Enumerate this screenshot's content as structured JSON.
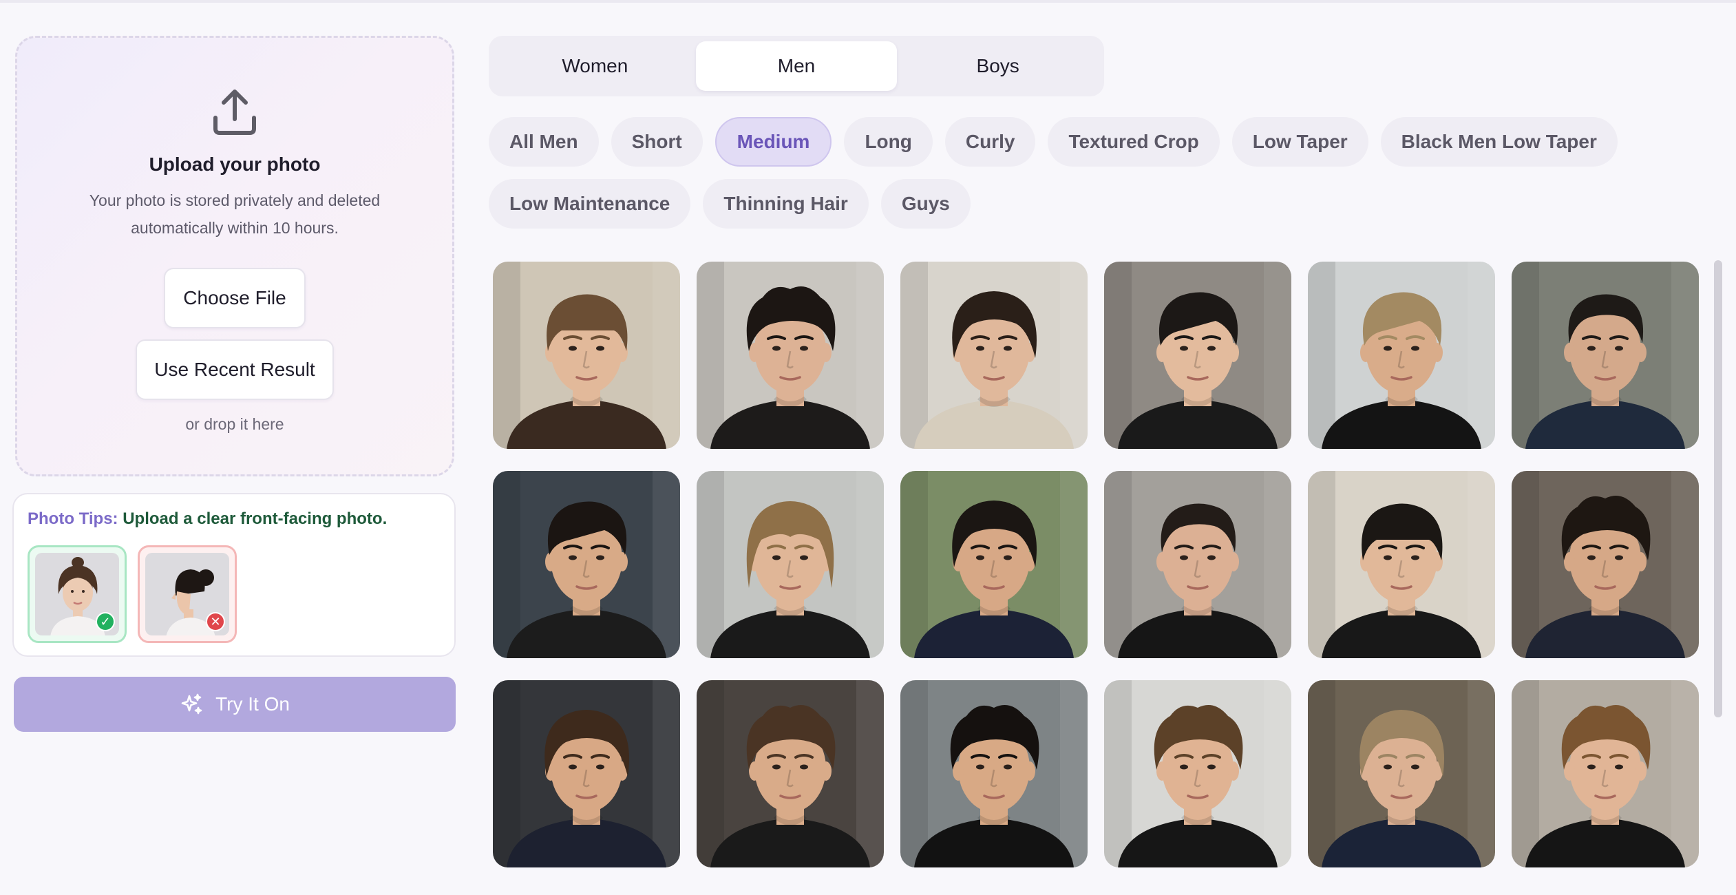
{
  "upload": {
    "title": "Upload your photo",
    "description": "Your photo is stored privately and deleted automatically within 10 hours.",
    "choose_file": "Choose File",
    "use_recent": "Use Recent Result",
    "drop_hint": "or drop it here"
  },
  "tips": {
    "label": "Photo Tips:",
    "message": "Upload a clear front-facing photo."
  },
  "try_button": "Try It On",
  "tabs": [
    "Women",
    "Men",
    "Boys"
  ],
  "active_tab": "Men",
  "filters": {
    "row1": [
      "All Men",
      "Short",
      "Medium",
      "Long",
      "Curly",
      "Textured Crop",
      "Low Taper",
      "Black Men Low Taper"
    ],
    "row2": [
      "Low Maintenance",
      "Thinning Hair",
      "Guys"
    ],
    "active": "Medium"
  },
  "colors": {
    "accent": "#6a55b8",
    "try_button": "#b2a8de",
    "tips_label": "#7b6ac8",
    "tips_message": "#1e5a3a"
  },
  "gallery": [
    {
      "bg": "#cfc6b6",
      "skin": "#e2b99a",
      "hair": "#6b4e34",
      "shirt": "#3a2a20",
      "style": "fringe"
    },
    {
      "bg": "#c9c6c0",
      "skin": "#ddb295",
      "hair": "#1c1613",
      "shirt": "#1d1b1a",
      "style": "curly"
    },
    {
      "bg": "#d8d4cc",
      "skin": "#e0b89b",
      "hair": "#2a1f18",
      "shirt": "#d6cdbd",
      "style": "wavy"
    },
    {
      "bg": "#8f8a84",
      "skin": "#e3bb9d",
      "hair": "#1c1816",
      "shirt": "#1a1a1a",
      "style": "swept"
    },
    {
      "bg": "#cfd2d2",
      "skin": "#d9ac8a",
      "hair": "#a38a62",
      "shirt": "#141414",
      "style": "swept"
    },
    {
      "bg": "#7c7f76",
      "skin": "#d4a98b",
      "hair": "#1e1a17",
      "shirt": "#1f2a3c",
      "style": "slick"
    },
    {
      "bg": "#3c444c",
      "skin": "#d8aa87",
      "hair": "#1b1512",
      "shirt": "#1c1c1c",
      "style": "swept"
    },
    {
      "bg": "#c3c5c2",
      "skin": "#e0b697",
      "hair": "#8f7048",
      "shirt": "#1a1a1a",
      "style": "long"
    },
    {
      "bg": "#7b8d66",
      "skin": "#d7a886",
      "hair": "#1b1613",
      "shirt": "#1c2236",
      "style": "wavy"
    },
    {
      "bg": "#a3a09b",
      "skin": "#dcb094",
      "hair": "#231c18",
      "shirt": "#161616",
      "style": "slick"
    },
    {
      "bg": "#d9d3c8",
      "skin": "#e1b899",
      "hair": "#1b1714",
      "shirt": "#181818",
      "style": "fringe"
    },
    {
      "bg": "#6e655c",
      "skin": "#d6a887",
      "hair": "#1e1712",
      "shirt": "#1f2433",
      "style": "curly"
    },
    {
      "bg": "#34363a",
      "skin": "#d8a885",
      "hair": "#3e2a1c",
      "shirt": "#1d2130",
      "style": "wavy"
    },
    {
      "bg": "#4a4440",
      "skin": "#d9ab89",
      "hair": "#4a3424",
      "shirt": "#1a1a1a",
      "style": "curly"
    },
    {
      "bg": "#7e8486",
      "skin": "#d8a985",
      "hair": "#15110f",
      "shirt": "#121212",
      "style": "curly"
    },
    {
      "bg": "#d7d7d4",
      "skin": "#e0b393",
      "hair": "#5c4128",
      "shirt": "#161616",
      "style": "curly"
    },
    {
      "bg": "#6d6354",
      "skin": "#dcb193",
      "hair": "#9c8462",
      "shirt": "#1b2337",
      "style": "wavy"
    },
    {
      "bg": "#b3aca2",
      "skin": "#e1b596",
      "hair": "#7b5531",
      "shirt": "#151515",
      "style": "curly"
    }
  ]
}
